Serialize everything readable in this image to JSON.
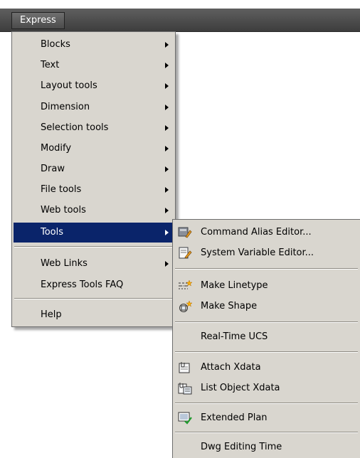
{
  "menubar": {
    "title": "Express"
  },
  "main_menu": {
    "items": [
      {
        "label": "Blocks",
        "has_submenu": true
      },
      {
        "label": "Text",
        "has_submenu": true
      },
      {
        "label": "Layout tools",
        "has_submenu": true
      },
      {
        "label": "Dimension",
        "has_submenu": true
      },
      {
        "label": "Selection tools",
        "has_submenu": true
      },
      {
        "label": "Modify",
        "has_submenu": true
      },
      {
        "label": "Draw",
        "has_submenu": true
      },
      {
        "label": "File tools",
        "has_submenu": true
      },
      {
        "label": "Web tools",
        "has_submenu": true
      },
      {
        "label": "Tools",
        "has_submenu": true,
        "highlighted": true
      },
      {
        "label": "Web Links",
        "has_submenu": true
      },
      {
        "label": "Express Tools FAQ",
        "has_submenu": false
      },
      {
        "label": "Help",
        "has_submenu": false
      }
    ]
  },
  "tools_submenu": {
    "items": [
      {
        "label": "Command Alias Editor...",
        "icon": "command-alias-icon"
      },
      {
        "label": "System Variable Editor...",
        "icon": "system-variable-icon"
      },
      {
        "label": "Make Linetype",
        "icon": "linetype-icon"
      },
      {
        "label": "Make Shape",
        "icon": "shape-icon"
      },
      {
        "label": "Real-Time UCS",
        "icon": ""
      },
      {
        "label": "Attach Xdata",
        "icon": "attach-xdata-icon"
      },
      {
        "label": "List Object Xdata",
        "icon": "list-xdata-icon"
      },
      {
        "label": "Extended Plan",
        "icon": "extended-plan-icon"
      },
      {
        "label": "Dwg Editing Time",
        "icon": ""
      }
    ]
  }
}
